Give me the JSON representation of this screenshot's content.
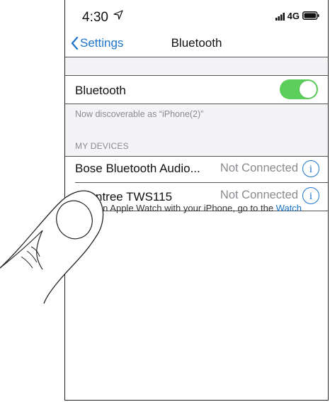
{
  "status_bar": {
    "time": "4:30",
    "network": "4G",
    "icons": [
      "location-arrow-icon",
      "signal-icon",
      "battery-icon"
    ]
  },
  "nav": {
    "back_label": "Settings",
    "title": "Bluetooth"
  },
  "bluetooth": {
    "label": "Bluetooth",
    "enabled": true,
    "discoverable_text": "Now discoverable as “iPhone(2)”"
  },
  "my_devices": {
    "header": "MY DEVICES",
    "devices": [
      {
        "name": "Bose Bluetooth Audio...",
        "status": "Not Connected",
        "info_glyph": "i"
      },
      {
        "name": "Avantree TWS115",
        "status": "Not Connected",
        "info_glyph": "i"
      }
    ]
  },
  "footer": {
    "text": "r an Apple Watch with your iPhone, go to the ",
    "link": "Watch"
  },
  "colors": {
    "accent": "#1a73c9",
    "toggle_on": "#5ccf5a",
    "secondary_text": "#8a8a8f"
  }
}
